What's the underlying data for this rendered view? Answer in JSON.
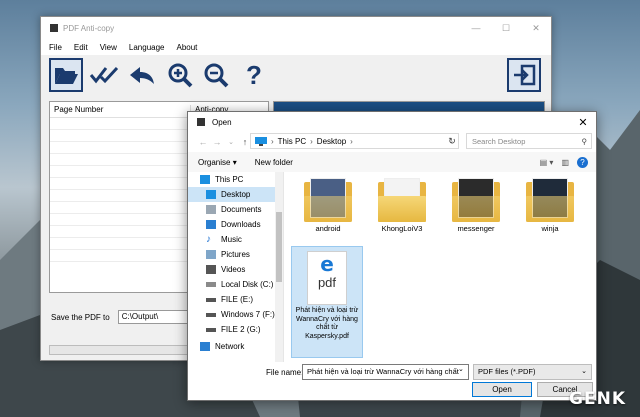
{
  "app": {
    "title": "PDF Anti-copy",
    "menu": [
      "File",
      "Edit",
      "View",
      "Language",
      "About"
    ],
    "toolbar": [
      "open-folder-icon",
      "check-icon",
      "undo-icon",
      "zoom-in-icon",
      "zoom-out-icon",
      "help-icon",
      "exit-icon"
    ],
    "columns": [
      "Page Number",
      "Anti-copy"
    ],
    "save_label": "Save the PDF to",
    "save_path": "C:\\Output\\",
    "progress": 0
  },
  "dialog": {
    "title": "Open",
    "breadcrumb": [
      "This PC",
      "Desktop"
    ],
    "search_placeholder": "Search Desktop",
    "organise": "Organise",
    "new_folder": "New folder",
    "nav": [
      {
        "label": "This PC",
        "icon": "pc-icon"
      },
      {
        "label": "Desktop",
        "icon": "desktop-icon"
      },
      {
        "label": "Documents",
        "icon": "documents-icon"
      },
      {
        "label": "Downloads",
        "icon": "downloads-icon"
      },
      {
        "label": "Music",
        "icon": "music-icon"
      },
      {
        "label": "Pictures",
        "icon": "pictures-icon"
      },
      {
        "label": "Videos",
        "icon": "videos-icon"
      },
      {
        "label": "Local Disk (C:)",
        "icon": "drive-icon"
      },
      {
        "label": "FILE (E:)",
        "icon": "drive-icon"
      },
      {
        "label": "Windows 7 (F:)",
        "icon": "drive-icon"
      },
      {
        "label": "FILE 2 (G:)",
        "icon": "drive-icon"
      },
      {
        "label": "Network",
        "icon": "network-icon"
      }
    ],
    "files": [
      {
        "label": "android"
      },
      {
        "label": "KhongLoiV3"
      },
      {
        "label": "messenger"
      },
      {
        "label": "winja"
      }
    ],
    "pdf": {
      "badge": "pdf",
      "label": "Phát hiện và loại trừ WannaCry với hàng chất từ Kaspersky.pdf"
    },
    "filename_label": "File name:",
    "filename_value": "Phát hiện và loại trừ WannaCry với hàng chất",
    "filter": "PDF files (*.PDF)",
    "open": "Open",
    "cancel": "Cancel"
  },
  "watermark": "GENK",
  "colors": {
    "accent": "#0078d7",
    "selection": "#cce4f7",
    "toolbar_icon": "#1b3b6e"
  }
}
